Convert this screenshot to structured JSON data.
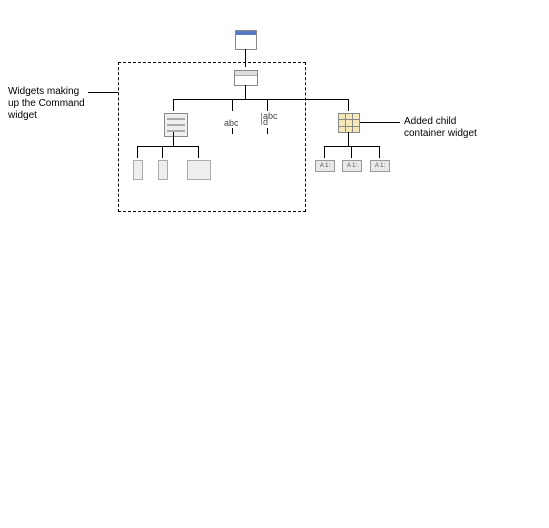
{
  "annotations": {
    "left_label_l1": "Widgets making",
    "left_label_l2": "up the Command",
    "left_label_l3": "widget",
    "right_label_l1": "Added child",
    "right_label_l2": "container widget"
  },
  "nodes": {
    "label_text": "abc",
    "textfield_l1": "abc",
    "textfield_l2": "d",
    "chip_text": "A 1:"
  }
}
